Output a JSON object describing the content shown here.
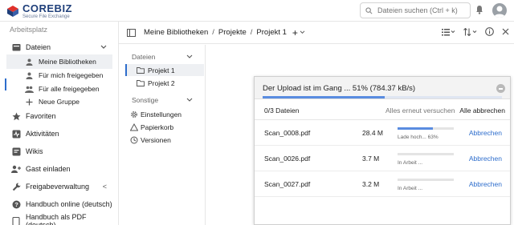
{
  "brand": {
    "name": "COREBIZ",
    "tagline": "Secure File Exchange",
    "colors": {
      "primary": "#1f3f7a",
      "red": "#e0312b",
      "accent": "#2d6dcc"
    }
  },
  "topbar": {
    "search_placeholder": "Dateien suchen (Ctrl + k)",
    "icons": [
      "search-icon",
      "bell-icon",
      "avatar"
    ]
  },
  "sidebar": {
    "section_title": "Arbeitsplatz",
    "files": {
      "label": "Dateien",
      "icon": "folder-icon",
      "expanded": true
    },
    "file_subitems": [
      {
        "label": "Meine Bibliotheken",
        "icon": "user-icon",
        "active": true
      },
      {
        "label": "Für mich freigegeben",
        "icon": "user-icon"
      },
      {
        "label": "Für alle freigegeben",
        "icon": "users-icon"
      },
      {
        "label": "Neue Gruppe",
        "icon": "plus-icon"
      }
    ],
    "items": [
      {
        "label": "Favoriten",
        "icon": "star-icon"
      },
      {
        "label": "Aktivitäten",
        "icon": "activity-icon"
      },
      {
        "label": "Wikis",
        "icon": "wiki-icon"
      },
      {
        "label": "Gast einladen",
        "icon": "user-plus-icon"
      },
      {
        "label": "Freigabeverwaltung",
        "icon": "wrench-icon",
        "chevron": "<"
      },
      {
        "label": "Handbuch online (deutsch)",
        "icon": "help-icon"
      },
      {
        "label": "Handbuch als PDF (deutsch)",
        "icon": "book-icon"
      }
    ]
  },
  "header": {
    "breadcrumbs": [
      "Meine Bibliotheken",
      "Projekte",
      "Projekt 1"
    ],
    "separator": "/",
    "add_label": "+"
  },
  "tree": {
    "files_title": "Dateien",
    "folders": [
      {
        "label": "Projekt 1",
        "selected": true
      },
      {
        "label": "Projekt 2",
        "selected": false
      }
    ],
    "other_title": "Sonstige",
    "other_items": [
      {
        "label": "Einstellungen",
        "icon": "gear-icon"
      },
      {
        "label": "Papierkorb",
        "icon": "trash-icon"
      },
      {
        "label": "Versionen",
        "icon": "history-icon"
      }
    ]
  },
  "upload": {
    "title": "Der Upload ist im Gang ...  51% (784.37 kB/s)",
    "overall_progress": 0.51,
    "count_label": "0/3 Dateien",
    "retry_all": "Alles erneut versuchen",
    "cancel_all": "Alle abbrechen",
    "files": [
      {
        "name": "Scan_0008.pdf",
        "size": "28.4 M",
        "progress": 0.63,
        "status": "Lade hoch... 63%",
        "cancel": "Abbrechen"
      },
      {
        "name": "Scan_0026.pdf",
        "size": "3.7 M",
        "progress": 0,
        "status": "In Arbeit ...",
        "cancel": "Abbrechen"
      },
      {
        "name": "Scan_0027.pdf",
        "size": "3.2 M",
        "progress": 0,
        "status": "In Arbeit ...",
        "cancel": "Abbrechen"
      }
    ]
  }
}
